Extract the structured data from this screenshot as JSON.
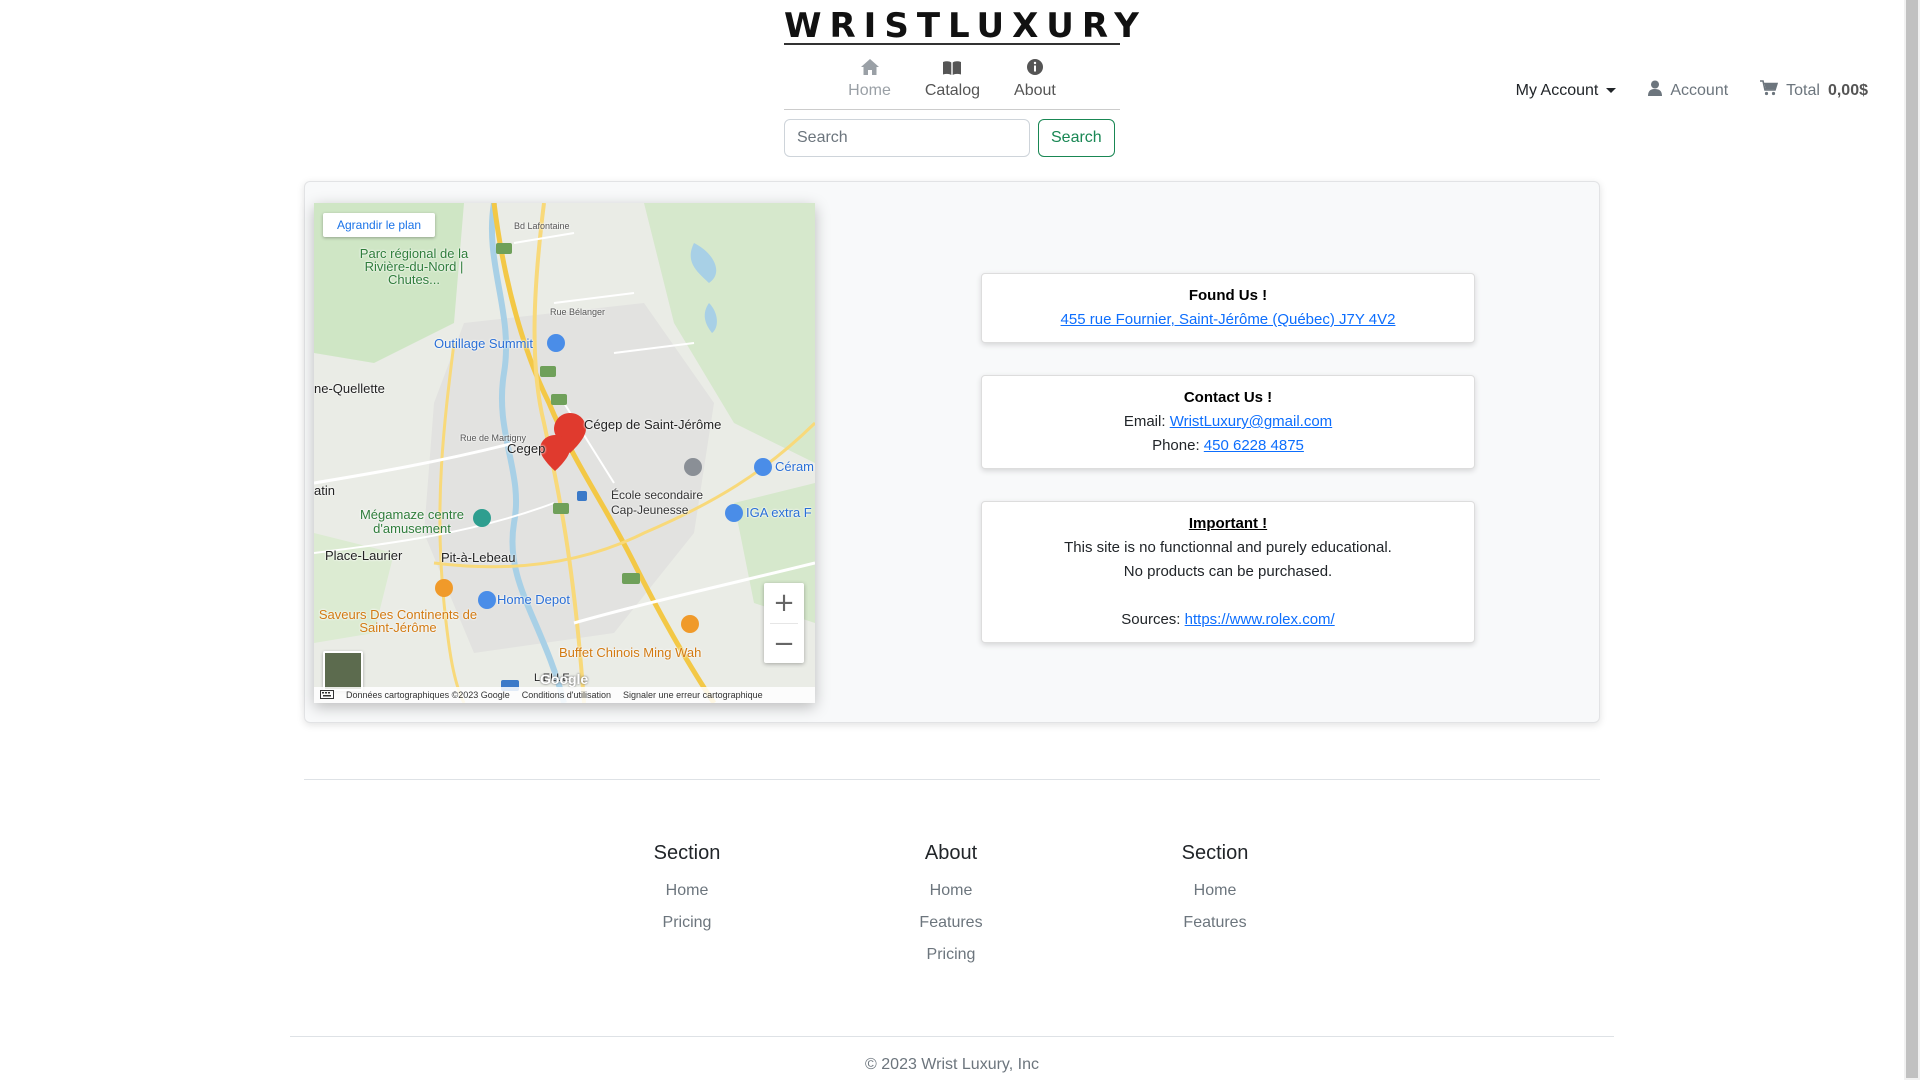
{
  "brand": {
    "name": "WRISTLUXURY"
  },
  "nav": [
    {
      "label": "Home",
      "icon": "home-icon"
    },
    {
      "label": "Catalog",
      "icon": "book-icon"
    },
    {
      "label": "About",
      "icon": "info-icon"
    }
  ],
  "search": {
    "placeholder": "Search",
    "button": "Search"
  },
  "account_bar": {
    "my_account": "My Account",
    "account": "Account",
    "total_label": "Total",
    "total_value": "0,00$"
  },
  "map": {
    "enlarge": "Agrandir le plan",
    "labels": {
      "parc": "Parc régional de la Rivière-du-Nord | Chutes...",
      "outillage": "Outillage Summit",
      "ne_quellette": "ne-Quellette",
      "cegep_sj": "Cégep de Saint-Jérôme",
      "cegep": "Cegep",
      "ecole": "École secondaire Cap-Jeunesse",
      "ceram": "Céram",
      "iga": "IGA extra F",
      "megamaze": "Mégamaze centre d'amusement",
      "place_laurier": "Place-Laurier",
      "pit": "Pit-à-Lebeau",
      "home_depot": "Home Depot",
      "saveurs": "Saveurs Des Continents de Saint-Jérôme",
      "buffet": "Buffet Chinois Ming Wah",
      "atin": "atin",
      "bd_lafontaine": "Bd Lafontaine",
      "rue_belanger": "Rue Bélanger",
      "rue_martigny": "Rue de Martigny",
      "ellelle": "L  ELLE",
      "google": "Google"
    },
    "footer": {
      "data": "Données cartographiques ©2023 Google",
      "terms": "Conditions d'utilisation",
      "report": "Signaler une erreur cartographique"
    }
  },
  "found": {
    "title": "Found Us !",
    "address": "455 rue Fournier, Saint-Jérôme (Québec) J7Y 4V2"
  },
  "contact": {
    "title": "Contact Us !",
    "email_label": "Email:",
    "email": "WristLuxury@gmail.com",
    "phone_label": "Phone:",
    "phone": "450 6228 4875"
  },
  "important": {
    "title": "Important !",
    "line1": "This site is no functionnal and purely educational.",
    "line2": "No products can be purchased.",
    "sources_label": "Sources:",
    "sources_link": "https://www.rolex.com/"
  },
  "footer": {
    "columns": [
      {
        "title": "Section",
        "links": [
          "Home",
          "Pricing"
        ]
      },
      {
        "title": "About",
        "links": [
          "Home",
          "Features",
          "Pricing"
        ]
      },
      {
        "title": "Section",
        "links": [
          "Home",
          "Features"
        ]
      }
    ],
    "copyright": "© 2023 Wrist Luxury, Inc"
  }
}
